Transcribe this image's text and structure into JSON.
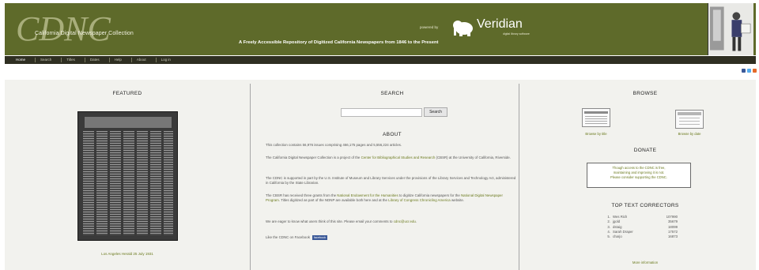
{
  "header": {
    "logo_letters": "CDNC",
    "site_name": "California Digital Newspaper Collection",
    "powered_by": "powered by",
    "veridian": "Veridian",
    "veridian_sub": "digital library software",
    "tagline": "A Freely Accessible Repository of Digitized California Newspapers from 1846 to the Present"
  },
  "nav": {
    "items": [
      "Home",
      "Search",
      "Titles",
      "Dates",
      "Help",
      "About",
      "Log in"
    ]
  },
  "featured": {
    "heading": "FEATURED",
    "caption": "Los Angeles Herald 25 July 1931"
  },
  "search": {
    "heading": "SEARCH",
    "button_label": "Search",
    "input_value": "",
    "input_placeholder": ""
  },
  "about": {
    "heading": "ABOUT",
    "p1": "This collection contains 56,976 issues comprising 466,175 pages and 5,556,224 articles.",
    "p2_pre": "The California Digital Newspaper Collection is a project of the ",
    "p2_link": "Center for Bibliographical Studies and Research",
    "p2_post": " (CBSR) at the University of California, Riverside.",
    "p3_pre": "The CDNC is supported in part by the U.S. Institute of Museum and Library Services under the provisions of the Library Services and Technology Act, administered in California by the State Librarian.",
    "p4_pre": "The CBSR has received three grants from the ",
    "p4_link1": "National Endowment for the Humanities",
    "p4_mid": " to digitize California newspapers for the ",
    "p4_link2": "National Digital Newspaper Program",
    "p4_post": ". Titles digitized as part of the NDNP are available both here and at the ",
    "p4_link3": "Library of Congress Chronicling America",
    "p4_end": " website.",
    "p5_pre": "We are eager to know what users think of this site. Please email your comments to ",
    "p5_link": "cdnc@ucr.edu",
    "p5_post": ".",
    "facebook_text": "Like the CDNC on Facebook",
    "facebook_button": "facebook"
  },
  "browse": {
    "heading": "BROWSE",
    "by_title": "Browse by title",
    "by_date": "Browse by date"
  },
  "donate": {
    "heading": "DONATE",
    "line1": "Though access to the CDNC is free,",
    "line2": "maintaining and improving it is not.",
    "line3": "Please consider supporting the CDNC."
  },
  "correctors": {
    "heading": "TOP TEXT CORRECTORS",
    "rows": [
      {
        "rank": "1.",
        "name": "Wes Rich",
        "count": "107990"
      },
      {
        "rank": "2.",
        "name": "jgold",
        "count": "35679"
      },
      {
        "rank": "3.",
        "name": "dstaig",
        "count": "18099"
      },
      {
        "rank": "4.",
        "name": "Sarah Draper",
        "count": "17572"
      },
      {
        "rank": "5.",
        "name": "charjo",
        "count": "16873"
      }
    ],
    "more": "More information"
  },
  "colors": {
    "header_bg": "#5e6a2a",
    "nav_bg": "#2f2f22",
    "link": "#6b7a1e",
    "content_bg": "#f2f2ee"
  }
}
